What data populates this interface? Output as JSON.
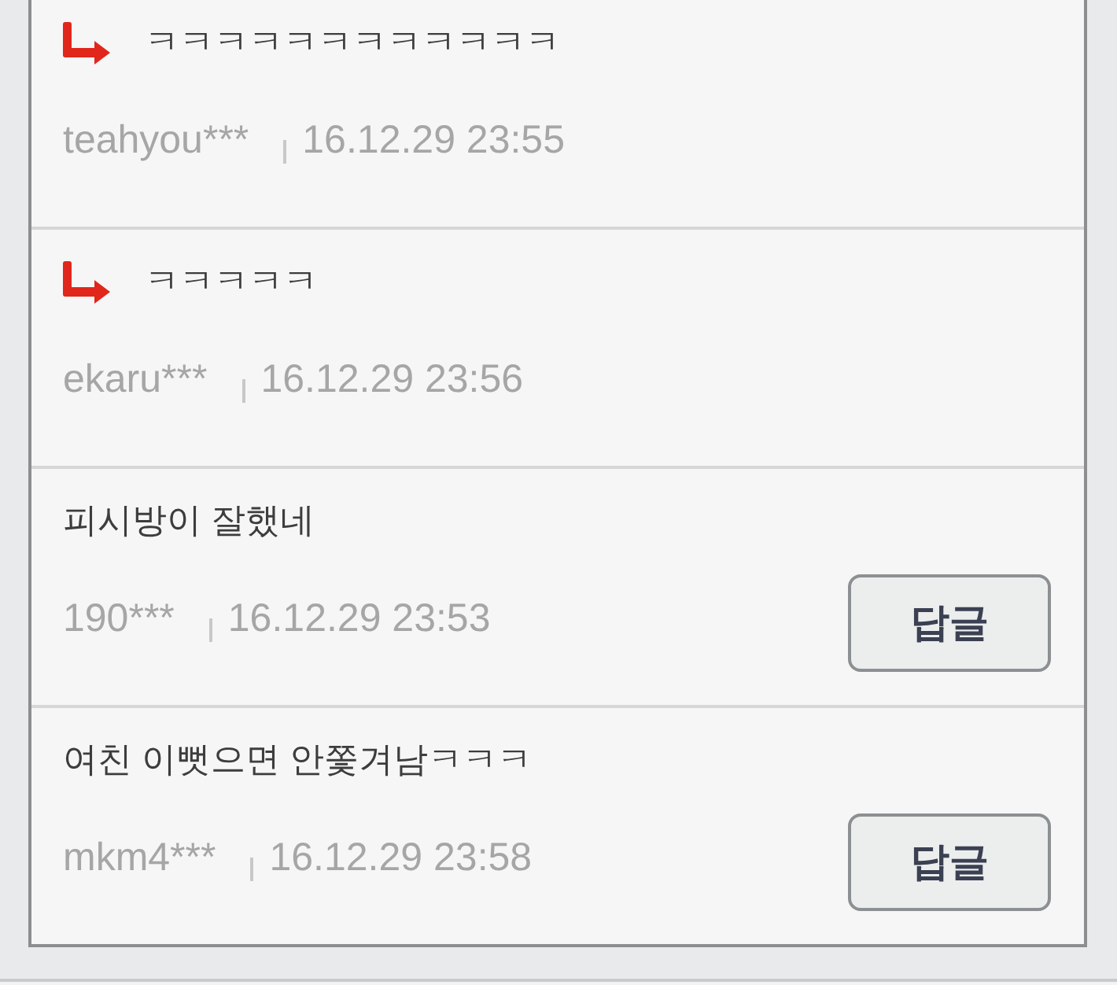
{
  "comments": [
    {
      "kind": "reply",
      "text": "ㅋㅋㅋㅋㅋㅋㅋㅋㅋㅋㅋㅋ",
      "author": "teahyou***",
      "date": "16.12.29 23:55"
    },
    {
      "kind": "reply",
      "text": "ㅋㅋㅋㅋㅋ",
      "author": "ekaru***",
      "date": "16.12.29 23:56"
    },
    {
      "kind": "comment",
      "text": "피시방이 잘했네",
      "author": "190***",
      "date": "16.12.29 23:53",
      "reply_button": "답글"
    },
    {
      "kind": "comment",
      "text": "여친 이뻣으면 안쫓겨남ㅋㅋㅋ",
      "author": "mkm4***",
      "date": "16.12.29 23:58",
      "reply_button": "답글"
    }
  ]
}
